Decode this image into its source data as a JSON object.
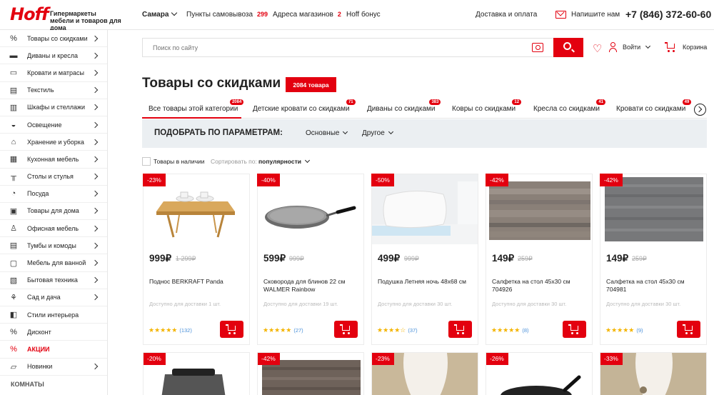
{
  "header": {
    "logo": "Hoff",
    "tagline": "Гипермаркеты мебели и товаров для дома",
    "city": "Самара",
    "pickup_label": "Пункты самовывоза",
    "pickup_count": "299",
    "stores_label": "Адреса магазинов",
    "stores_count": "2",
    "bonus_label": "Hoff бонус",
    "delivery_label": "Доставка и оплата",
    "write_label": "Напишите нам",
    "phone": "+7 (846) 372-60-60"
  },
  "sidebar": {
    "items": [
      {
        "label": "Товары со скидками",
        "icon": "percent-icon"
      },
      {
        "label": "Диваны и кресла",
        "icon": "sofa-icon"
      },
      {
        "label": "Кровати и матрасы",
        "icon": "bed-icon"
      },
      {
        "label": "Текстиль",
        "icon": "textile-icon"
      },
      {
        "label": "Шкафы и стеллажи",
        "icon": "wardrobe-icon"
      },
      {
        "label": "Освещение",
        "icon": "lamp-icon"
      },
      {
        "label": "Хранение и уборка",
        "icon": "storage-icon"
      },
      {
        "label": "Кухонная мебель",
        "icon": "kitchen-icon"
      },
      {
        "label": "Столы и стулья",
        "icon": "table-icon"
      },
      {
        "label": "Посуда",
        "icon": "dishes-icon"
      },
      {
        "label": "Товары для дома",
        "icon": "home-goods-icon"
      },
      {
        "label": "Офисная мебель",
        "icon": "office-chair-icon"
      },
      {
        "label": "Тумбы и комоды",
        "icon": "dresser-icon"
      },
      {
        "label": "Мебель для ванной",
        "icon": "bath-icon"
      },
      {
        "label": "Бытовая техника",
        "icon": "appliance-icon"
      },
      {
        "label": "Сад и дача",
        "icon": "garden-icon"
      },
      {
        "label": "Стили интерьера",
        "icon": "style-icon"
      },
      {
        "label": "Дисконт",
        "icon": "discount-icon"
      },
      {
        "label": "АКЦИИ",
        "icon": "sale-icon"
      },
      {
        "label": "Новинки",
        "icon": "new-icon"
      }
    ],
    "rooms_heading": "КОМНАТЫ"
  },
  "search": {
    "placeholder": "Поиск по сайту"
  },
  "account": {
    "login_label": "Войти",
    "cart_label": "Корзина"
  },
  "page": {
    "title": "Товары со скидками",
    "count_badge": "2084 товара"
  },
  "tabs": [
    {
      "label": "Все товары этой категории",
      "badge": "2084"
    },
    {
      "label": "Детские кровати со скидками",
      "badge": "71"
    },
    {
      "label": "Диваны со скидками",
      "badge": "383"
    },
    {
      "label": "Ковры со скидками",
      "badge": "12"
    },
    {
      "label": "Кресла со скидками",
      "badge": "41"
    },
    {
      "label": "Кровати со скидками",
      "badge": "49"
    }
  ],
  "filter": {
    "title": "ПОДОБРАТЬ ПО ПАРАМЕТРАМ:",
    "opt1": "Основные",
    "opt2": "Другое"
  },
  "sort": {
    "in_stock_label": "Товары в наличии",
    "sort_label": "Сортировать по:",
    "sort_value": "популярности"
  },
  "products": [
    {
      "discount": "-23%",
      "price": "999₽",
      "old_price": "1 299₽",
      "name": "Поднос BERKRAFT Panda",
      "ship": "Доступно для доставки 1 шт.",
      "stars": "★★★★★",
      "reviews": "(132)"
    },
    {
      "discount": "-40%",
      "price": "599₽",
      "old_price": "999₽",
      "name": "Сковорода для блинов 22 см WALMER Rainbow",
      "ship": "Доступно для доставки 19 шт.",
      "stars": "★★★★★",
      "reviews": "(27)"
    },
    {
      "discount": "-50%",
      "price": "499₽",
      "old_price": "999₽",
      "name": "Подушка Летняя ночь 48х68 см",
      "ship": "Доступно для доставки 30 шт.",
      "stars": "★★★★☆",
      "reviews": "(37)"
    },
    {
      "discount": "-42%",
      "price": "149₽",
      "old_price": "259₽",
      "name": "Салфетка на стол 45х30 см 704926",
      "ship": "Доступно для доставки 30 шт.",
      "stars": "★★★★★",
      "reviews": "(8)"
    },
    {
      "discount": "-42%",
      "price": "149₽",
      "old_price": "259₽",
      "name": "Салфетка на стол 45х30 см 704981",
      "ship": "Доступно для доставки 30 шт.",
      "stars": "★★★★★",
      "reviews": "(9)"
    }
  ],
  "products_row2": [
    {
      "discount": "-20%"
    },
    {
      "discount": "-42%"
    },
    {
      "discount": "-23%"
    },
    {
      "discount": "-26%"
    },
    {
      "discount": "-33%"
    }
  ]
}
